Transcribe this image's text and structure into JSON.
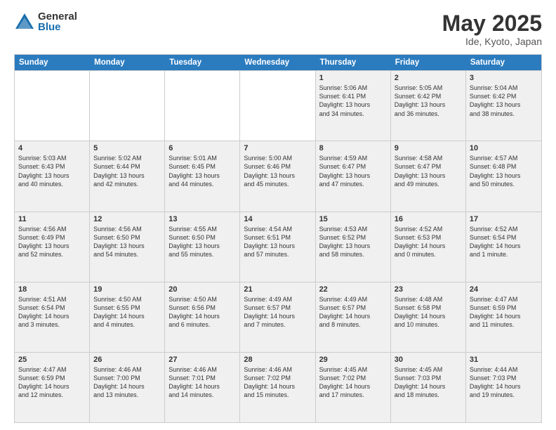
{
  "logo": {
    "general": "General",
    "blue": "Blue"
  },
  "title": "May 2025",
  "subtitle": "Ide, Kyoto, Japan",
  "header_days": [
    "Sunday",
    "Monday",
    "Tuesday",
    "Wednesday",
    "Thursday",
    "Friday",
    "Saturday"
  ],
  "rows": [
    [
      {
        "day": "",
        "info": "",
        "empty": true
      },
      {
        "day": "",
        "info": "",
        "empty": true
      },
      {
        "day": "",
        "info": "",
        "empty": true
      },
      {
        "day": "",
        "info": "",
        "empty": true
      },
      {
        "day": "1",
        "info": "Sunrise: 5:06 AM\nSunset: 6:41 PM\nDaylight: 13 hours\nand 34 minutes.",
        "empty": false
      },
      {
        "day": "2",
        "info": "Sunrise: 5:05 AM\nSunset: 6:42 PM\nDaylight: 13 hours\nand 36 minutes.",
        "empty": false
      },
      {
        "day": "3",
        "info": "Sunrise: 5:04 AM\nSunset: 6:42 PM\nDaylight: 13 hours\nand 38 minutes.",
        "empty": false
      }
    ],
    [
      {
        "day": "4",
        "info": "Sunrise: 5:03 AM\nSunset: 6:43 PM\nDaylight: 13 hours\nand 40 minutes.",
        "empty": false
      },
      {
        "day": "5",
        "info": "Sunrise: 5:02 AM\nSunset: 6:44 PM\nDaylight: 13 hours\nand 42 minutes.",
        "empty": false
      },
      {
        "day": "6",
        "info": "Sunrise: 5:01 AM\nSunset: 6:45 PM\nDaylight: 13 hours\nand 44 minutes.",
        "empty": false
      },
      {
        "day": "7",
        "info": "Sunrise: 5:00 AM\nSunset: 6:46 PM\nDaylight: 13 hours\nand 45 minutes.",
        "empty": false
      },
      {
        "day": "8",
        "info": "Sunrise: 4:59 AM\nSunset: 6:47 PM\nDaylight: 13 hours\nand 47 minutes.",
        "empty": false
      },
      {
        "day": "9",
        "info": "Sunrise: 4:58 AM\nSunset: 6:47 PM\nDaylight: 13 hours\nand 49 minutes.",
        "empty": false
      },
      {
        "day": "10",
        "info": "Sunrise: 4:57 AM\nSunset: 6:48 PM\nDaylight: 13 hours\nand 50 minutes.",
        "empty": false
      }
    ],
    [
      {
        "day": "11",
        "info": "Sunrise: 4:56 AM\nSunset: 6:49 PM\nDaylight: 13 hours\nand 52 minutes.",
        "empty": false
      },
      {
        "day": "12",
        "info": "Sunrise: 4:56 AM\nSunset: 6:50 PM\nDaylight: 13 hours\nand 54 minutes.",
        "empty": false
      },
      {
        "day": "13",
        "info": "Sunrise: 4:55 AM\nSunset: 6:50 PM\nDaylight: 13 hours\nand 55 minutes.",
        "empty": false
      },
      {
        "day": "14",
        "info": "Sunrise: 4:54 AM\nSunset: 6:51 PM\nDaylight: 13 hours\nand 57 minutes.",
        "empty": false
      },
      {
        "day": "15",
        "info": "Sunrise: 4:53 AM\nSunset: 6:52 PM\nDaylight: 13 hours\nand 58 minutes.",
        "empty": false
      },
      {
        "day": "16",
        "info": "Sunrise: 4:52 AM\nSunset: 6:53 PM\nDaylight: 14 hours\nand 0 minutes.",
        "empty": false
      },
      {
        "day": "17",
        "info": "Sunrise: 4:52 AM\nSunset: 6:54 PM\nDaylight: 14 hours\nand 1 minute.",
        "empty": false
      }
    ],
    [
      {
        "day": "18",
        "info": "Sunrise: 4:51 AM\nSunset: 6:54 PM\nDaylight: 14 hours\nand 3 minutes.",
        "empty": false
      },
      {
        "day": "19",
        "info": "Sunrise: 4:50 AM\nSunset: 6:55 PM\nDaylight: 14 hours\nand 4 minutes.",
        "empty": false
      },
      {
        "day": "20",
        "info": "Sunrise: 4:50 AM\nSunset: 6:56 PM\nDaylight: 14 hours\nand 6 minutes.",
        "empty": false
      },
      {
        "day": "21",
        "info": "Sunrise: 4:49 AM\nSunset: 6:57 PM\nDaylight: 14 hours\nand 7 minutes.",
        "empty": false
      },
      {
        "day": "22",
        "info": "Sunrise: 4:49 AM\nSunset: 6:57 PM\nDaylight: 14 hours\nand 8 minutes.",
        "empty": false
      },
      {
        "day": "23",
        "info": "Sunrise: 4:48 AM\nSunset: 6:58 PM\nDaylight: 14 hours\nand 10 minutes.",
        "empty": false
      },
      {
        "day": "24",
        "info": "Sunrise: 4:47 AM\nSunset: 6:59 PM\nDaylight: 14 hours\nand 11 minutes.",
        "empty": false
      }
    ],
    [
      {
        "day": "25",
        "info": "Sunrise: 4:47 AM\nSunset: 6:59 PM\nDaylight: 14 hours\nand 12 minutes.",
        "empty": false
      },
      {
        "day": "26",
        "info": "Sunrise: 4:46 AM\nSunset: 7:00 PM\nDaylight: 14 hours\nand 13 minutes.",
        "empty": false
      },
      {
        "day": "27",
        "info": "Sunrise: 4:46 AM\nSunset: 7:01 PM\nDaylight: 14 hours\nand 14 minutes.",
        "empty": false
      },
      {
        "day": "28",
        "info": "Sunrise: 4:46 AM\nSunset: 7:02 PM\nDaylight: 14 hours\nand 15 minutes.",
        "empty": false
      },
      {
        "day": "29",
        "info": "Sunrise: 4:45 AM\nSunset: 7:02 PM\nDaylight: 14 hours\nand 17 minutes.",
        "empty": false
      },
      {
        "day": "30",
        "info": "Sunrise: 4:45 AM\nSunset: 7:03 PM\nDaylight: 14 hours\nand 18 minutes.",
        "empty": false
      },
      {
        "day": "31",
        "info": "Sunrise: 4:44 AM\nSunset: 7:03 PM\nDaylight: 14 hours\nand 19 minutes.",
        "empty": false
      }
    ]
  ]
}
